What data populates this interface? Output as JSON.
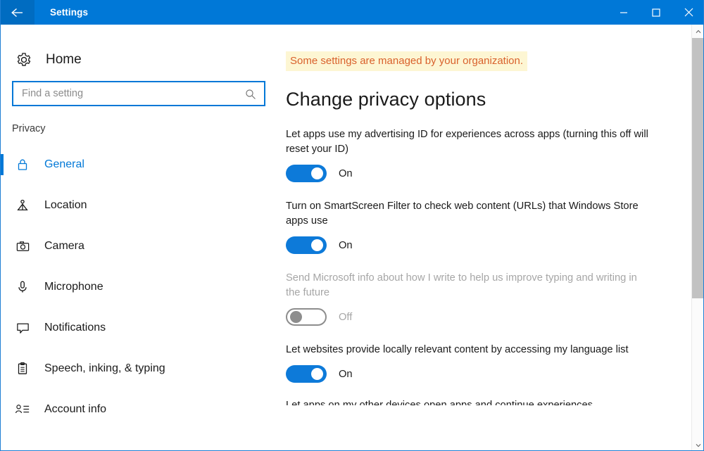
{
  "titlebar": {
    "title": "Settings",
    "back_icon": "back-arrow-icon",
    "minimize_label": "Minimize",
    "maximize_label": "Maximize",
    "close_label": "Close",
    "background_color": "#0078d7"
  },
  "sidebar": {
    "home_label": "Home",
    "home_icon": "gear-icon",
    "search": {
      "placeholder": "Find a setting",
      "value": "",
      "icon": "search-icon"
    },
    "section_title": "Privacy",
    "items": [
      {
        "label": "General",
        "icon": "lock-icon",
        "active": true
      },
      {
        "label": "Location",
        "icon": "location-pin-icon",
        "active": false
      },
      {
        "label": "Camera",
        "icon": "camera-icon",
        "active": false
      },
      {
        "label": "Microphone",
        "icon": "microphone-icon",
        "active": false
      },
      {
        "label": "Notifications",
        "icon": "speech-bubble-icon",
        "active": false
      },
      {
        "label": "Speech, inking, & typing",
        "icon": "clipboard-icon",
        "active": false
      },
      {
        "label": "Account info",
        "icon": "account-info-icon",
        "active": false
      }
    ],
    "accent_color": "#0078d7"
  },
  "content": {
    "banner": {
      "text": "Some settings are managed by your organization.",
      "background_color": "#fdf6d3",
      "text_color": "#d9612c"
    },
    "heading": "Change privacy options",
    "settings": [
      {
        "text": "Let apps use my advertising ID for experiences across apps (turning this off will reset your ID)",
        "state": "On",
        "enabled": true
      },
      {
        "text": "Turn on SmartScreen Filter to check web content (URLs) that Windows Store apps use",
        "state": "On",
        "enabled": true
      },
      {
        "text": "Send Microsoft info about how I write to help us improve typing and writing in the future",
        "state": "Off",
        "enabled": false
      },
      {
        "text": "Let websites provide locally relevant content by accessing my language list",
        "state": "On",
        "enabled": true
      }
    ],
    "partial_setting_text": "Let apps on my other devices open apps and continue experiences",
    "toggle_on_color": "#0d7ad9",
    "toggle_off_color": "#8d8d8d"
  },
  "scrollbar": {
    "up_arrow": "chevron-up-icon",
    "down_arrow": "chevron-down-icon",
    "thumb": "scrollbar-thumb"
  }
}
